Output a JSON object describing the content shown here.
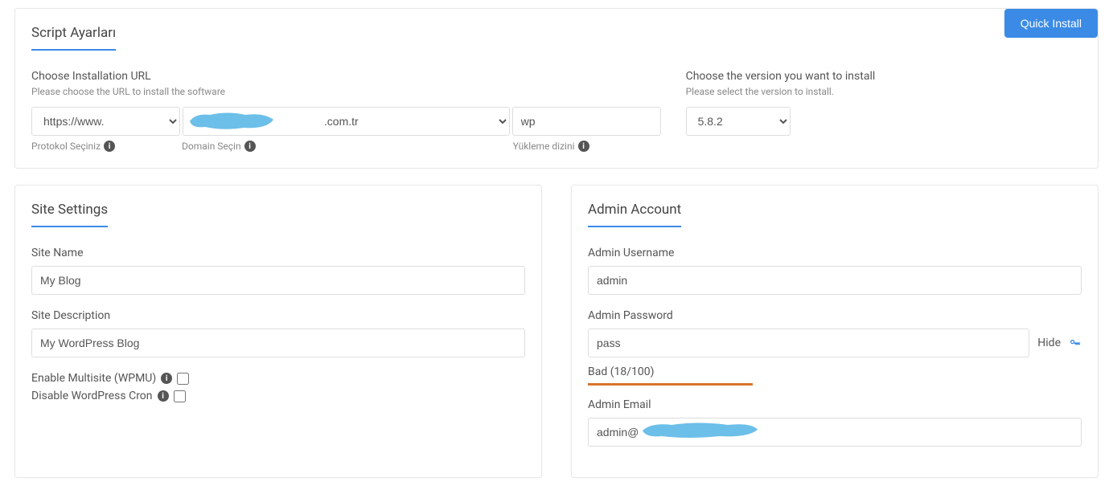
{
  "scriptSettings": {
    "title": "Script Ayarları",
    "quickInstall": "Quick Install",
    "installUrl": {
      "label": "Choose Installation URL",
      "help": "Please choose the URL to install the software",
      "protocolValue": "https://www.",
      "domainValue": ".com.tr",
      "dirValue": "wp",
      "protocolSub": "Protokol Seçiniz",
      "domainSub": "Domain Seçin",
      "dirSub": "Yükleme dizini"
    },
    "version": {
      "label": "Choose the version you want to install",
      "help": "Please select the version to install.",
      "value": "5.8.2"
    }
  },
  "siteSettings": {
    "title": "Site Settings",
    "siteName": {
      "label": "Site Name",
      "value": "My Blog"
    },
    "siteDesc": {
      "label": "Site Description",
      "value": "My WordPress Blog"
    },
    "multisite": "Enable Multisite (WPMU)",
    "disableCron": "Disable WordPress Cron"
  },
  "adminAccount": {
    "title": "Admin Account",
    "username": {
      "label": "Admin Username",
      "value": "admin"
    },
    "password": {
      "label": "Admin Password",
      "value": "pass",
      "hide": "Hide",
      "strength": "Bad (18/100)"
    },
    "email": {
      "label": "Admin Email",
      "value": "admin@"
    }
  }
}
